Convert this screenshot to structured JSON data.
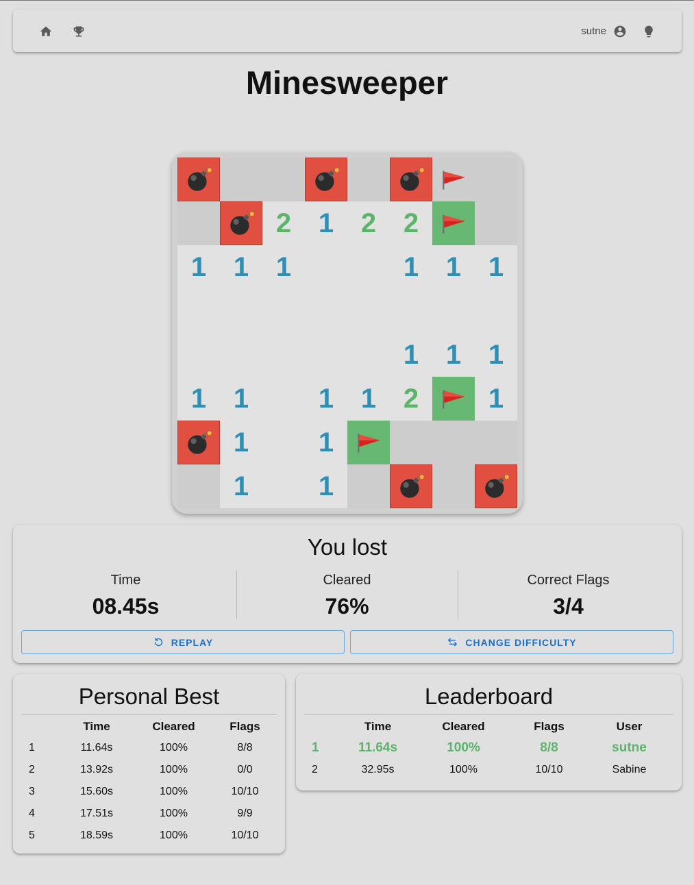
{
  "user": {
    "name": "sutne"
  },
  "icons": {
    "home": "home-icon",
    "trophy": "trophy-icon",
    "account": "account-circle-icon",
    "hint": "lightbulb-icon",
    "mine": "bomb-icon",
    "flag": "flag-icon",
    "replay": "replay-icon",
    "swap": "swap-icon"
  },
  "colors": {
    "mine_cell": "#e04f3f",
    "correct_flag_cell": "#66b873",
    "number_1": "#2f8fb4",
    "number_2": "#5bb46a",
    "accent": "#1f6fc4"
  },
  "title": "Minesweeper",
  "board": {
    "rows": 8,
    "cols": 8,
    "cells": [
      [
        "mine",
        "closed",
        "closed",
        "mine",
        "closed",
        "mine",
        "flag",
        "closed"
      ],
      [
        "closed",
        "mine",
        "2",
        "1",
        "2",
        "2",
        "flagok",
        "closed"
      ],
      [
        "1",
        "1",
        "1",
        "0",
        "0",
        "1",
        "1",
        "1"
      ],
      [
        "0",
        "0",
        "0",
        "0",
        "0",
        "0",
        "0",
        "0"
      ],
      [
        "0",
        "0",
        "0",
        "0",
        "0",
        "1",
        "1",
        "1"
      ],
      [
        "1",
        "1",
        "0",
        "1",
        "1",
        "2",
        "flagok",
        "1"
      ],
      [
        "mine",
        "1",
        "0",
        "1",
        "flagok",
        "closed",
        "closed",
        "closed"
      ],
      [
        "closed",
        "1",
        "0",
        "1",
        "closed",
        "mine",
        "closed",
        "mine"
      ]
    ]
  },
  "result": {
    "title": "You lost",
    "stats": [
      {
        "label": "Time",
        "value": "08.45s"
      },
      {
        "label": "Cleared",
        "value": "76%"
      },
      {
        "label": "Correct Flags",
        "value": "3/4"
      }
    ],
    "replay_label": "REPLAY",
    "change_difficulty_label": "CHANGE DIFFICULTY"
  },
  "personal_best": {
    "title": "Personal Best",
    "columns": [
      "",
      "Time",
      "Cleared",
      "Flags"
    ],
    "rows": [
      [
        "1",
        "11.64s",
        "100%",
        "8/8"
      ],
      [
        "2",
        "13.92s",
        "100%",
        "0/0"
      ],
      [
        "3",
        "15.60s",
        "100%",
        "10/10"
      ],
      [
        "4",
        "17.51s",
        "100%",
        "9/9"
      ],
      [
        "5",
        "18.59s",
        "100%",
        "10/10"
      ]
    ]
  },
  "leaderboard": {
    "title": "Leaderboard",
    "columns": [
      "",
      "Time",
      "Cleared",
      "Flags",
      "User"
    ],
    "rows": [
      [
        "1",
        "11.64s",
        "100%",
        "8/8",
        "sutne"
      ],
      [
        "2",
        "32.95s",
        "100%",
        "10/10",
        "Sabine"
      ]
    ],
    "highlight_row": 0
  }
}
